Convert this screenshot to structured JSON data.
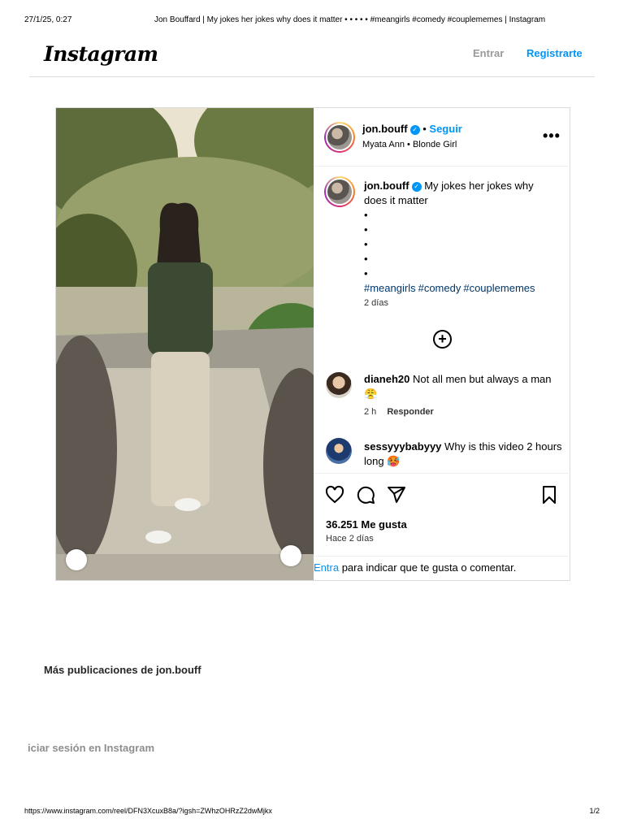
{
  "print": {
    "date": "27/1/25, 0:27",
    "title": "Jon Bouffard | My jokes her jokes why does it matter • • • • • #meangirls #comedy #couplememes | Instagram",
    "url": "https://www.instagram.com/reel/DFN3XcuxB8a/?igsh=ZWhzOHRzZ2dwMjkx",
    "page": "1/2"
  },
  "topbar": {
    "logo": "Instagram",
    "login": "Entrar",
    "signup": "Registrarte"
  },
  "post": {
    "header": {
      "username": "jon.bouff",
      "verified_mark": "✓",
      "separator": "•",
      "follow": "Seguir",
      "audio": "Myata Ann • Blonde Girl",
      "more_icon": "more-horizontal-icon"
    },
    "caption": {
      "username": "jon.bouff",
      "text": "My jokes her jokes why does it matter",
      "bullets": [
        "•",
        "•",
        "•",
        "•",
        "•"
      ],
      "hashtags": [
        "#meangirls",
        "#comedy",
        "#couplememes"
      ],
      "time": "2 días"
    },
    "comments": [
      {
        "username": "dianeh20",
        "text": "Not all men but always a man 😤",
        "time": "2 h",
        "reply": "Responder"
      },
      {
        "username": "sessyyybabyyy",
        "text": "Why is this video 2 hours long 🥵"
      }
    ],
    "likes": "36.251 Me gusta",
    "ago": "Hace 2 días",
    "login_prompt": {
      "link": "Entra",
      "text": " para indicar que te gusta o comentar."
    }
  },
  "more_posts": "Más publicaciones de jon.bouff",
  "login_ig": "iciar sesión en Instagram",
  "colors": {
    "accent": "#0095f6",
    "hashtag": "#00376b",
    "border": "#dbdbdb"
  }
}
